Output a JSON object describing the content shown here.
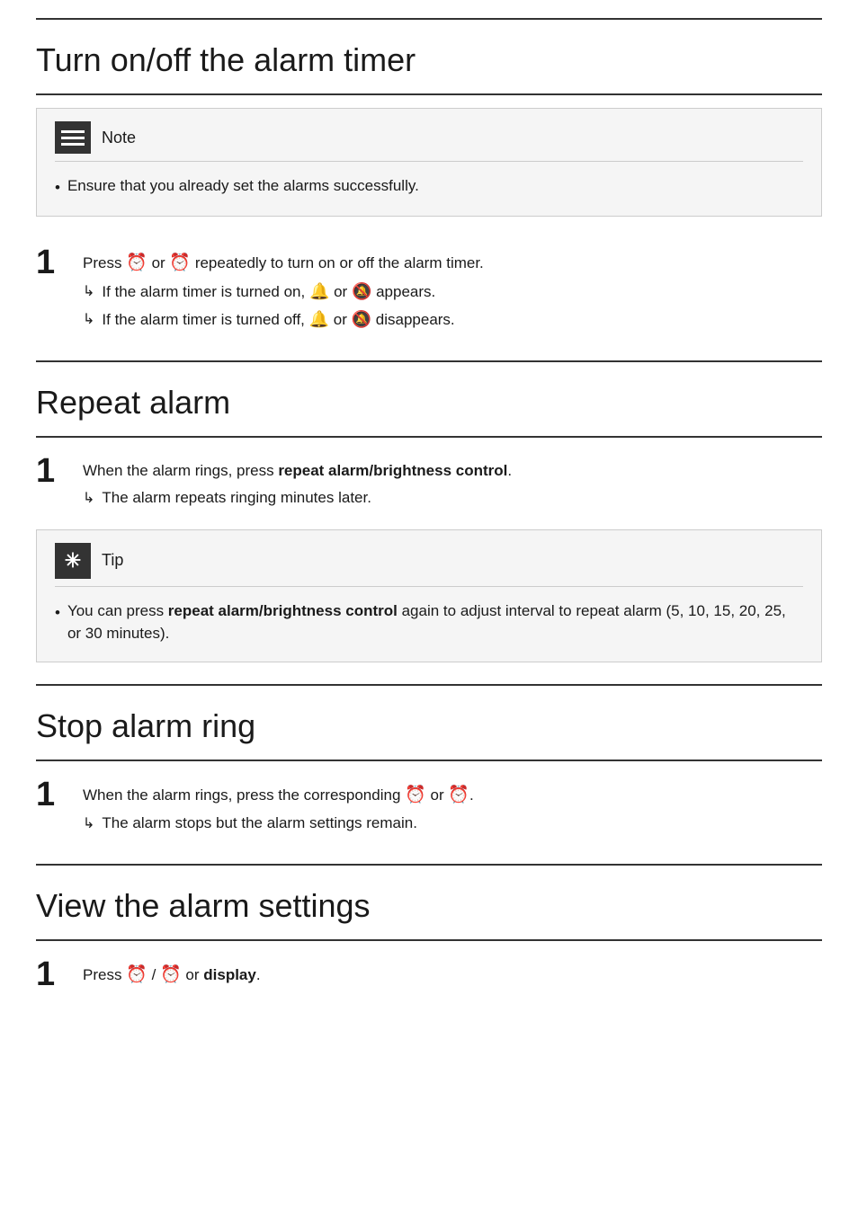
{
  "sections": {
    "turn_on_off": {
      "title": "Turn on/off the alarm timer",
      "note_label": "Note",
      "note_items": [
        "Ensure that you already set the alarms successfully."
      ],
      "steps": [
        {
          "number": "1",
          "main": "Press {alarm1} or {alarm2} repeatedly to turn on or off the alarm timer.",
          "sub": [
            "If the alarm timer is turned on, {icon_wave_left} or {icon_wave_right} appears.",
            "If the alarm timer is turned off, {icon_wave_left} or {icon_wave_right} disappears."
          ]
        }
      ]
    },
    "repeat_alarm": {
      "title": "Repeat alarm",
      "steps": [
        {
          "number": "1",
          "main_prefix": "When the alarm rings, press ",
          "main_bold": "repeat alarm/brightness control",
          "main_suffix": ".",
          "sub": [
            "The alarm repeats ringing minutes later."
          ]
        }
      ],
      "tip_label": "Tip",
      "tip_items": [
        {
          "prefix": "You can press ",
          "bold": "repeat alarm/brightness control",
          "suffix": " again to adjust interval to repeat alarm (5, 10, 15, 20, 25, or 30 minutes)."
        }
      ]
    },
    "stop_alarm": {
      "title": "Stop alarm ring",
      "steps": [
        {
          "number": "1",
          "main_prefix": "When the alarm rings, press the corresponding ",
          "main_suffix": "or {alarm2}.",
          "sub": [
            "The alarm stops but the alarm settings remain."
          ]
        }
      ]
    },
    "view_alarm": {
      "title": "View the alarm settings",
      "steps": [
        {
          "number": "1",
          "main": "Press {alarm1} / {alarm2} or display."
        }
      ]
    }
  },
  "icons": {
    "alarm_bell_1": "⏰",
    "alarm_bell_2": "⏰",
    "wave_left": "🔔",
    "wave_right": "🔔",
    "arrow_right": "↳",
    "bullet": "•",
    "asterisk": "✳"
  }
}
